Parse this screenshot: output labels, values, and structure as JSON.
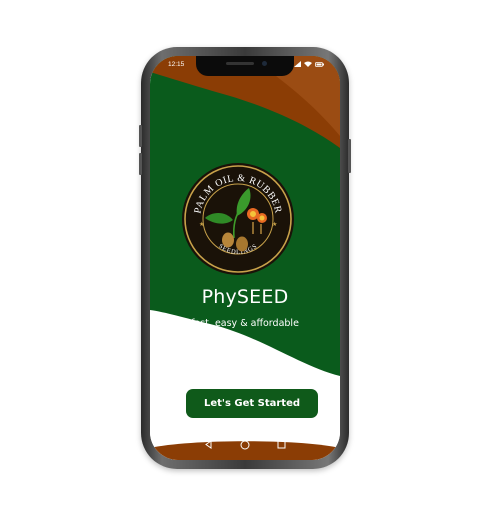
{
  "status_bar": {
    "time": "12:15",
    "icons": [
      "signal-icon",
      "wifi-icon",
      "battery-icon"
    ]
  },
  "logo": {
    "top_text": "PALM OIL & RUBBER",
    "bottom_text": "SEEDLINGS"
  },
  "app": {
    "name": "PhySEED",
    "tagline": "fast, easy & affordable"
  },
  "cta": {
    "label": "Let's Get Started"
  },
  "nav_bar": {
    "buttons": [
      "back-icon",
      "home-icon",
      "recents-icon"
    ]
  },
  "colors": {
    "green": "#0a5b1c",
    "brown": "#8b3d05",
    "light_brown": "#b0642a",
    "button": "#0f5a1a",
    "logo_gold": "#c8a24a"
  }
}
